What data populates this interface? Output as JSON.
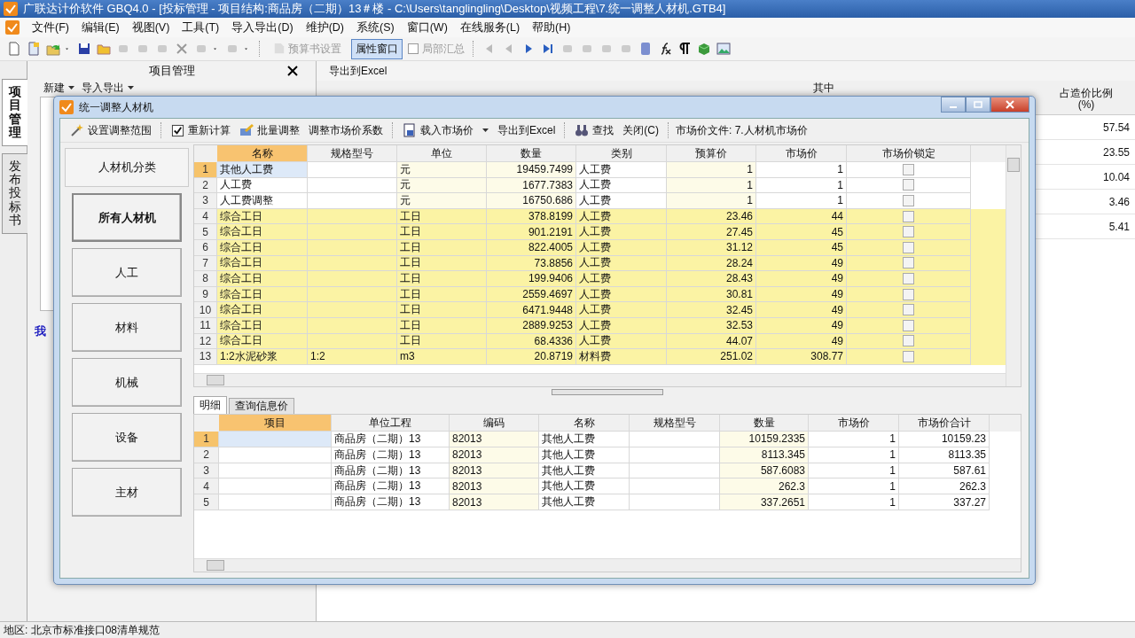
{
  "window": {
    "title": "广联达计价软件 GBQ4.0 - [投标管理 - 项目结构:商品房（二期）13＃楼 - C:\\Users\\tanglingling\\Desktop\\视频工程\\7.统一调整人材机.GTB4]"
  },
  "menu": [
    "文件(F)",
    "编辑(E)",
    "视图(V)",
    "工具(T)",
    "导入导出(D)",
    "维护(D)",
    "系统(S)",
    "窗口(W)",
    "在线服务(L)",
    "帮助(H)"
  ],
  "toolbar": [
    {
      "label": "预算书设置",
      "kind": "button",
      "disabled": true,
      "selected": false
    },
    {
      "label": "属性窗口",
      "kind": "button",
      "disabled": false,
      "selected": true
    },
    {
      "label": "局部汇总",
      "kind": "checkbox",
      "disabled": true,
      "checked": false
    }
  ],
  "side_tabs": [
    {
      "label": "项目管理",
      "selected": true
    },
    {
      "label": "发布投标书",
      "selected": false
    }
  ],
  "project_panel": {
    "title": "项目管理",
    "toolbar": [
      "新建",
      "导入导出"
    ],
    "tree_label": "我"
  },
  "workarea": {
    "export": "导出到Excel",
    "group_header": "其中",
    "share_header": "占造价比例",
    "share_unit": "(%)",
    "share_values": [
      "57.54",
      "23.55",
      "10.04",
      "3.46",
      "5.41"
    ]
  },
  "dialog": {
    "title": "统一调整人材机",
    "toolbar": [
      {
        "label": "设置调整范围",
        "dropdown": false
      },
      {
        "label": "重新计算",
        "dropdown": false
      },
      {
        "label": "批量调整",
        "dropdown": false
      },
      {
        "label": "调整市场价系数",
        "dropdown": false
      },
      {
        "label": "载入市场价",
        "dropdown": true
      },
      {
        "label": "导出到Excel",
        "dropdown": false
      },
      {
        "label": "查找",
        "dropdown": false
      },
      {
        "label": "关闭(C)",
        "dropdown": false
      }
    ],
    "market_file": "市场价文件: 7.人材机市场价",
    "categories": {
      "header": "人材机分类",
      "items": [
        {
          "label": "所有人材机",
          "selected": true
        },
        {
          "label": "人工",
          "selected": false
        },
        {
          "label": "材料",
          "selected": false
        },
        {
          "label": "机械",
          "selected": false
        },
        {
          "label": "设备",
          "selected": false
        },
        {
          "label": "主材",
          "selected": false
        }
      ]
    },
    "grid": {
      "columns": [
        {
          "label": "名称",
          "selected": true
        },
        {
          "label": "规格型号",
          "selected": false
        },
        {
          "label": "单位",
          "selected": false
        },
        {
          "label": "数量",
          "selected": false
        },
        {
          "label": "类别",
          "selected": false
        },
        {
          "label": "预算价",
          "selected": false
        },
        {
          "label": "市场价",
          "selected": false
        },
        {
          "label": "市场价锁定",
          "selected": false
        }
      ],
      "rows": [
        {
          "no": "1",
          "name": "其他人工费",
          "unit": "元",
          "qty": "19459.7499",
          "category": "人工费",
          "budget": "1",
          "market": "1",
          "locked": false,
          "selected": true,
          "highlighted": false
        },
        {
          "no": "2",
          "name": "人工费",
          "unit": "元",
          "qty": "1677.7383",
          "category": "人工费",
          "budget": "1",
          "market": "1",
          "locked": false,
          "selected": false,
          "highlighted": false
        },
        {
          "no": "3",
          "name": "人工费调整",
          "unit": "元",
          "qty": "16750.686",
          "category": "人工费",
          "budget": "1",
          "market": "1",
          "locked": false,
          "selected": false,
          "highlighted": false
        },
        {
          "no": "4",
          "name": "综合工日",
          "unit": "工日",
          "qty": "378.8199",
          "category": "人工费",
          "budget": "23.46",
          "market": "44",
          "locked": false,
          "selected": false,
          "highlighted": true
        },
        {
          "no": "5",
          "name": "综合工日",
          "unit": "工日",
          "qty": "901.2191",
          "category": "人工费",
          "budget": "27.45",
          "market": "45",
          "locked": false,
          "selected": false,
          "highlighted": true
        },
        {
          "no": "6",
          "name": "综合工日",
          "unit": "工日",
          "qty": "822.4005",
          "category": "人工费",
          "budget": "31.12",
          "market": "45",
          "locked": false,
          "selected": false,
          "highlighted": true
        },
        {
          "no": "7",
          "name": "综合工日",
          "unit": "工日",
          "qty": "73.8856",
          "category": "人工费",
          "budget": "28.24",
          "market": "49",
          "locked": false,
          "selected": false,
          "highlighted": true
        },
        {
          "no": "8",
          "name": "综合工日",
          "unit": "工日",
          "qty": "199.9406",
          "category": "人工费",
          "budget": "28.43",
          "market": "49",
          "locked": false,
          "selected": false,
          "highlighted": true
        },
        {
          "no": "9",
          "name": "综合工日",
          "unit": "工日",
          "qty": "2559.4697",
          "category": "人工费",
          "budget": "30.81",
          "market": "49",
          "locked": false,
          "selected": false,
          "highlighted": true
        },
        {
          "no": "10",
          "name": "综合工日",
          "unit": "工日",
          "qty": "6471.9448",
          "category": "人工费",
          "budget": "32.45",
          "market": "49",
          "locked": false,
          "selected": false,
          "highlighted": true
        },
        {
          "no": "11",
          "name": "综合工日",
          "unit": "工日",
          "qty": "2889.9253",
          "category": "人工费",
          "budget": "32.53",
          "market": "49",
          "locked": false,
          "selected": false,
          "highlighted": true
        },
        {
          "no": "12",
          "name": "综合工日",
          "unit": "工日",
          "qty": "68.4336",
          "category": "人工费",
          "budget": "44.07",
          "market": "49",
          "locked": false,
          "selected": false,
          "highlighted": true
        },
        {
          "no": "13",
          "name": "1:2水泥砂浆",
          "spec": "1:2",
          "unit": "m3",
          "qty": "20.8719",
          "category": "材料费",
          "budget": "251.02",
          "market": "308.77",
          "locked": false,
          "selected": false,
          "highlighted": true
        }
      ]
    },
    "detail_tabs": [
      {
        "label": "明细",
        "selected": true
      },
      {
        "label": "查询信息价",
        "selected": false
      }
    ],
    "detail_grid": {
      "columns": [
        {
          "label": "项目",
          "selected": true
        },
        {
          "label": "单位工程",
          "selected": false
        },
        {
          "label": "编码",
          "selected": false
        },
        {
          "label": "名称",
          "selected": false
        },
        {
          "label": "规格型号",
          "selected": false
        },
        {
          "label": "数量",
          "selected": false
        },
        {
          "label": "市场价",
          "selected": false
        },
        {
          "label": "市场价合计",
          "selected": false
        }
      ],
      "rows": [
        {
          "no": "1",
          "unit_project": "商品房（二期）13",
          "code": "82013",
          "name": "其他人工费",
          "qty": "10159.2335",
          "market": "1",
          "total": "10159.23",
          "selected": true
        },
        {
          "no": "2",
          "unit_project": "商品房（二期）13",
          "code": "82013",
          "name": "其他人工费",
          "qty": "8113.345",
          "market": "1",
          "total": "8113.35",
          "selected": false
        },
        {
          "no": "3",
          "unit_project": "商品房（二期）13",
          "code": "82013",
          "name": "其他人工费",
          "qty": "587.6083",
          "market": "1",
          "total": "587.61",
          "selected": false
        },
        {
          "no": "4",
          "unit_project": "商品房（二期）13",
          "code": "82013",
          "name": "其他人工费",
          "qty": "262.3",
          "market": "1",
          "total": "262.3",
          "selected": false
        },
        {
          "no": "5",
          "unit_project": "商品房（二期）13",
          "code": "82013",
          "name": "其他人工费",
          "qty": "337.2651",
          "market": "1",
          "total": "337.27",
          "selected": false
        }
      ]
    }
  },
  "status_bar": "地区: 北京市标准接口08清单规范"
}
